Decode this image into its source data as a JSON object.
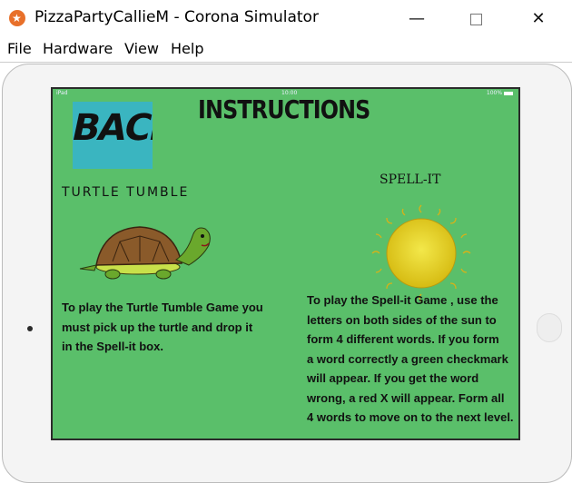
{
  "window": {
    "title": "PizzaPartyCallieM - Corona Simulator",
    "minimize": "—",
    "close": "✕"
  },
  "menu": [
    "File",
    "Hardware",
    "View",
    "Help"
  ],
  "status_bar": {
    "carrier": "iPad",
    "time": "10:00",
    "battery": "100%"
  },
  "screen": {
    "back_button": "BACK",
    "heading": "INSTRUCTIONS",
    "turtle_title": "TURTLE TUMBLE",
    "spell_title": "SPELL-IT",
    "turtle_lines": [
      "To play the Turtle Tumble Game you",
      "must pick up the turtle and drop it",
      " in the Spell-it box."
    ],
    "spell_lines": [
      "To play the Spell-it Game , use the",
      "letters on both sides of the sun to",
      "form 4 different words. If you form",
      "a word correctly a green checkmark",
      "will appear. If you get the word",
      "wrong, a red X will appear. Form all",
      "4 words to move on to the next level."
    ]
  },
  "colors": {
    "screen_bg": "#5abf6a",
    "back_bg": "#3ab5c0",
    "sun": "#e0cc1c"
  }
}
